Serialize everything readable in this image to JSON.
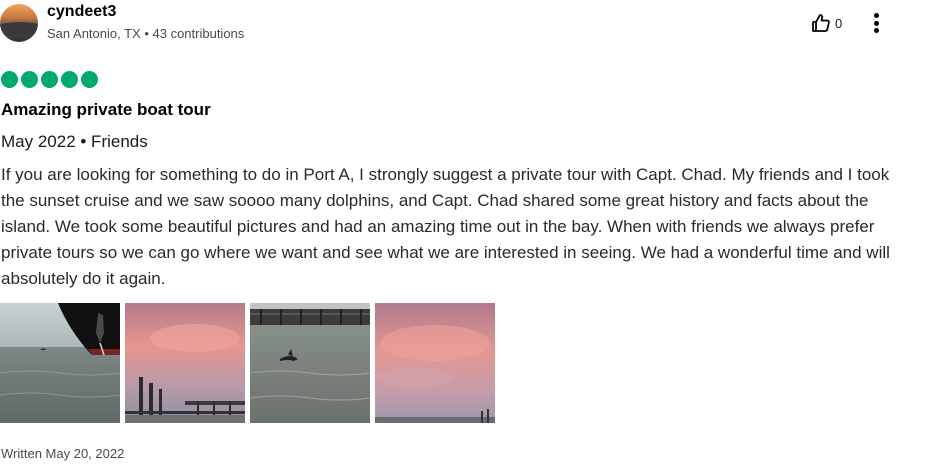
{
  "user": {
    "name": "cyndeet3",
    "meta": "San Antonio, TX • 43 contributions",
    "avatar_icon": "user-avatar-sunset"
  },
  "actions": {
    "helpful_count": "0",
    "helpful_icon": "thumbs-up-icon",
    "more_icon": "more-vertical-icon"
  },
  "review": {
    "rating": 5,
    "rating_max": 5,
    "rating_color": "#00aa6c",
    "title": "Amazing private boat tour",
    "trip_info": "May 2022 • Friends",
    "body": "If you are looking for something to do in Port A, I strongly suggest a private tour with Capt. Chad. My friends and I took the sunset cruise and we saw soooo many dolphins, and Capt. Chad shared some great history and facts about the island. We took some beautiful pictures and had an amazing time out in the bay. When with friends we always prefer private tours so we can go where we want and see what we are interested in seeing. We had a wonderful time and will absolutely do it again.",
    "written_date": "Written May 20, 2022"
  },
  "photos": [
    {
      "subject": "ship-hull-and-dolphin"
    },
    {
      "subject": "pink-sunset-sky-with-pier"
    },
    {
      "subject": "dolphin-in-water-by-dock"
    },
    {
      "subject": "pink-sunset-clouds"
    }
  ]
}
